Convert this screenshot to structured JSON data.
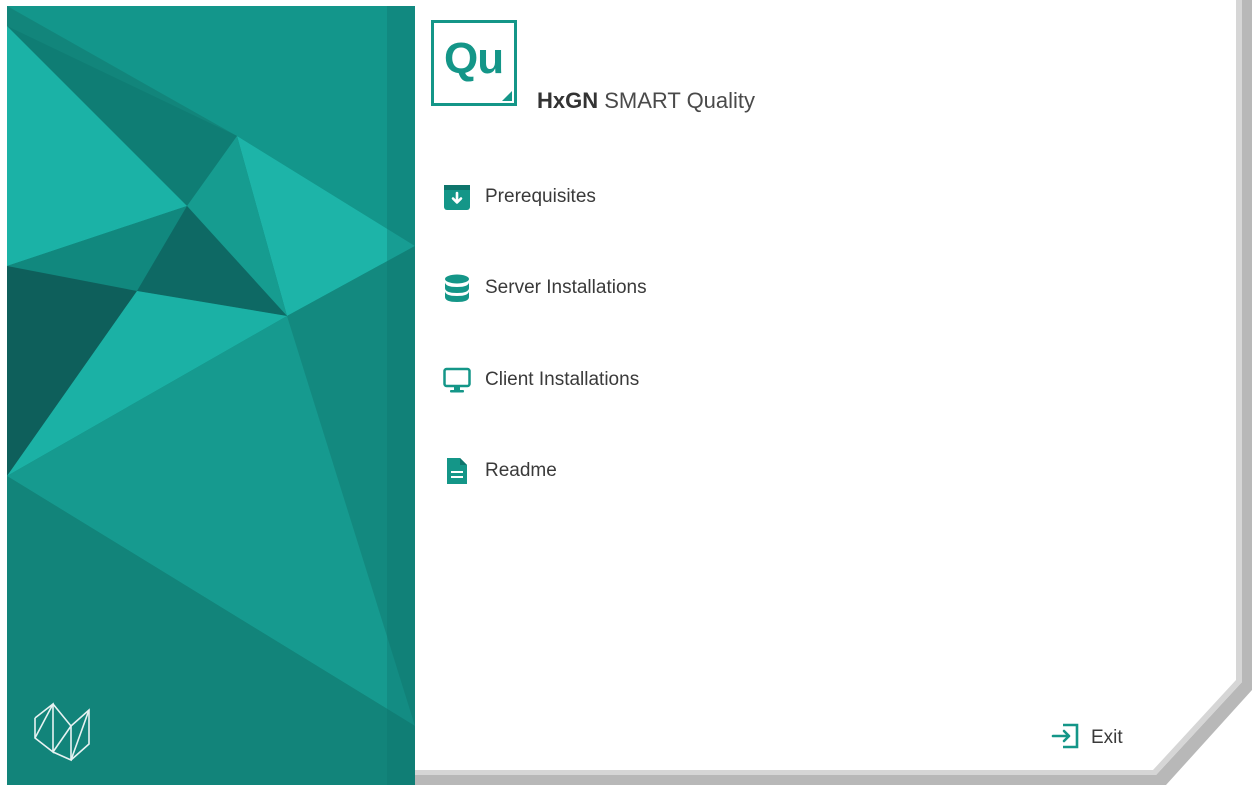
{
  "colors": {
    "accent": "#149688",
    "panel_dark": "#0e6a64",
    "panel_mid": "#12867c",
    "panel_light": "#1cb5a9",
    "text": "#3a3a3a",
    "frame_shadow": "#b5b5b5"
  },
  "header": {
    "logo_text": "Qu",
    "brand": "HxGN",
    "product": "SMART Quality"
  },
  "menu": {
    "items": [
      {
        "label": "Prerequisites",
        "icon": "download-box-icon"
      },
      {
        "label": "Server Installations",
        "icon": "database-icon"
      },
      {
        "label": "Client Installations",
        "icon": "monitor-icon"
      },
      {
        "label": "Readme",
        "icon": "document-icon"
      }
    ]
  },
  "footer": {
    "exit_label": "Exit",
    "exit_icon": "exit-icon"
  },
  "branding": {
    "company_logo_icon": "hexagon-logo-icon"
  }
}
